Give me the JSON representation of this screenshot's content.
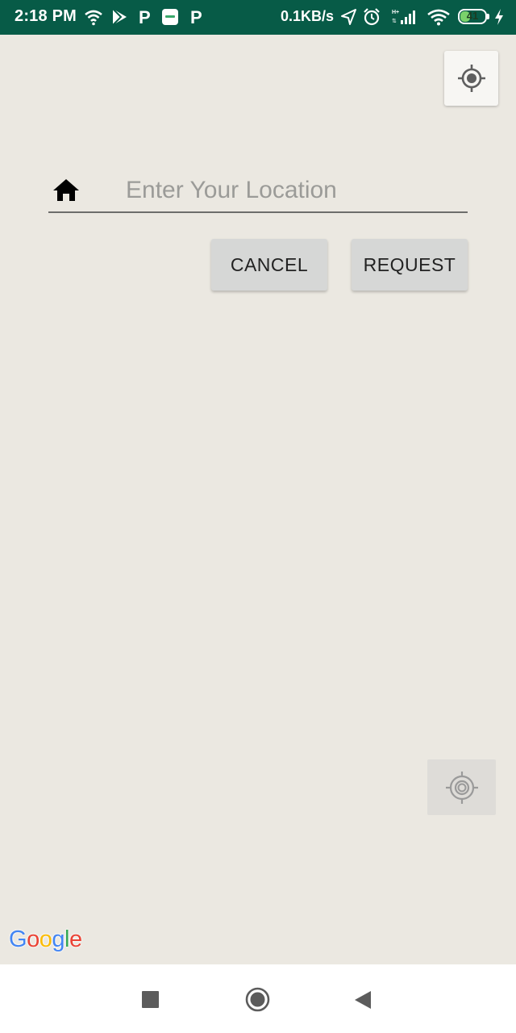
{
  "status_bar": {
    "time": "2:18 PM",
    "network_speed": "0.1KB/s",
    "battery_level": "41",
    "battery_fraction": 0.41,
    "icons": [
      "wifi-icon",
      "play-store-icon",
      "paytm-icon",
      "app-notification-icon",
      "paytm-icon",
      "location-arrow-icon",
      "alarm-icon",
      "signal-icon",
      "wifi-icon",
      "battery-icon",
      "charging-icon"
    ]
  },
  "location": {
    "placeholder": "Enter Your Location",
    "value": "",
    "icon": "home-icon"
  },
  "buttons": {
    "cancel_label": "CANCEL",
    "request_label": "REQUEST"
  },
  "map": {
    "locate_top_icon": "my-location-icon",
    "locate_bottom_icon": "gps-crosshair-icon",
    "google_logo": {
      "letters": [
        "G",
        "o",
        "o",
        "g",
        "l",
        "e"
      ],
      "colors": [
        "#4285f4",
        "#ea4335",
        "#fbbc05",
        "#4285f4",
        "#34a853",
        "#ea4335"
      ]
    }
  },
  "colors": {
    "status_bar_bg": "#075b47",
    "map_bg": "#ebe8e1",
    "button_bg": "#d6d7d6"
  },
  "nav_bar": {
    "items": [
      "recent-apps",
      "home",
      "back"
    ]
  }
}
